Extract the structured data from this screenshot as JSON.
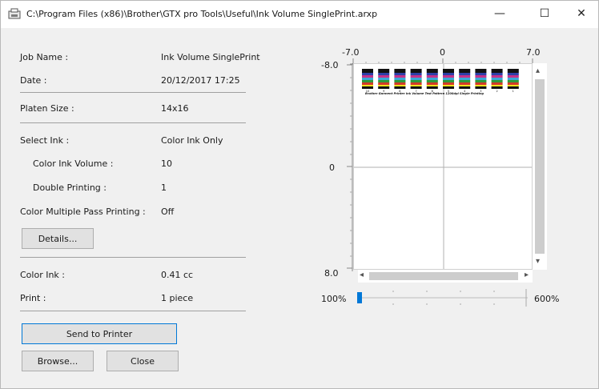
{
  "window": {
    "title": "C:\\Program Files (x86)\\Brother\\GTX pro Tools\\Useful\\Ink Volume SinglePrint.arxp",
    "minimize_glyph": "—",
    "maximize_glyph": "☐",
    "close_glyph": "✕"
  },
  "info": {
    "job_name_label": "Job Name :",
    "job_name_value": "Ink Volume SinglePrint",
    "date_label": "Date :",
    "date_value": "20/12/2017 17:25",
    "platen_size_label": "Platen Size :",
    "platen_size_value": "14x16",
    "select_ink_label": "Select Ink :",
    "select_ink_value": "Color Ink Only",
    "color_ink_volume_label": "Color Ink Volume :",
    "color_ink_volume_value": "10",
    "double_printing_label": "Double Printing :",
    "double_printing_value": "1",
    "color_multiple_pass_label": "Color Multiple Pass Printing :",
    "color_multiple_pass_value": "Off",
    "color_ink_label": "Color Ink :",
    "color_ink_value": "0.41 cc",
    "print_label": "Print :",
    "print_value": "1 piece"
  },
  "buttons": {
    "details": "Details...",
    "send_to_printer": "Send to Printer",
    "browse": "Browse...",
    "close": "Close"
  },
  "preview": {
    "x_min": "-7.0",
    "x_mid": "0",
    "x_max": "7.0",
    "y_min": "-8.0",
    "y_mid": "0",
    "y_max": "8.0",
    "pattern_caption": "Brother Garment Printer Ink Volume Test Pattern 1200dpi    Single Printing",
    "pattern_numbers": [
      "10",
      "9",
      "8",
      "7",
      "6",
      "5",
      "4",
      "3",
      "2",
      "1"
    ],
    "zoom_min": "100%",
    "zoom_max": "600%",
    "zoom_level": 0
  },
  "colors": {
    "accent": "#0078d7",
    "cyan": "#3aa7d8",
    "magenta": "#c4338a",
    "yellow": "#f2e21c",
    "green": "#2e9a3c",
    "red": "#d23a2a",
    "blue": "#2d3fa8",
    "black": "#111111"
  }
}
